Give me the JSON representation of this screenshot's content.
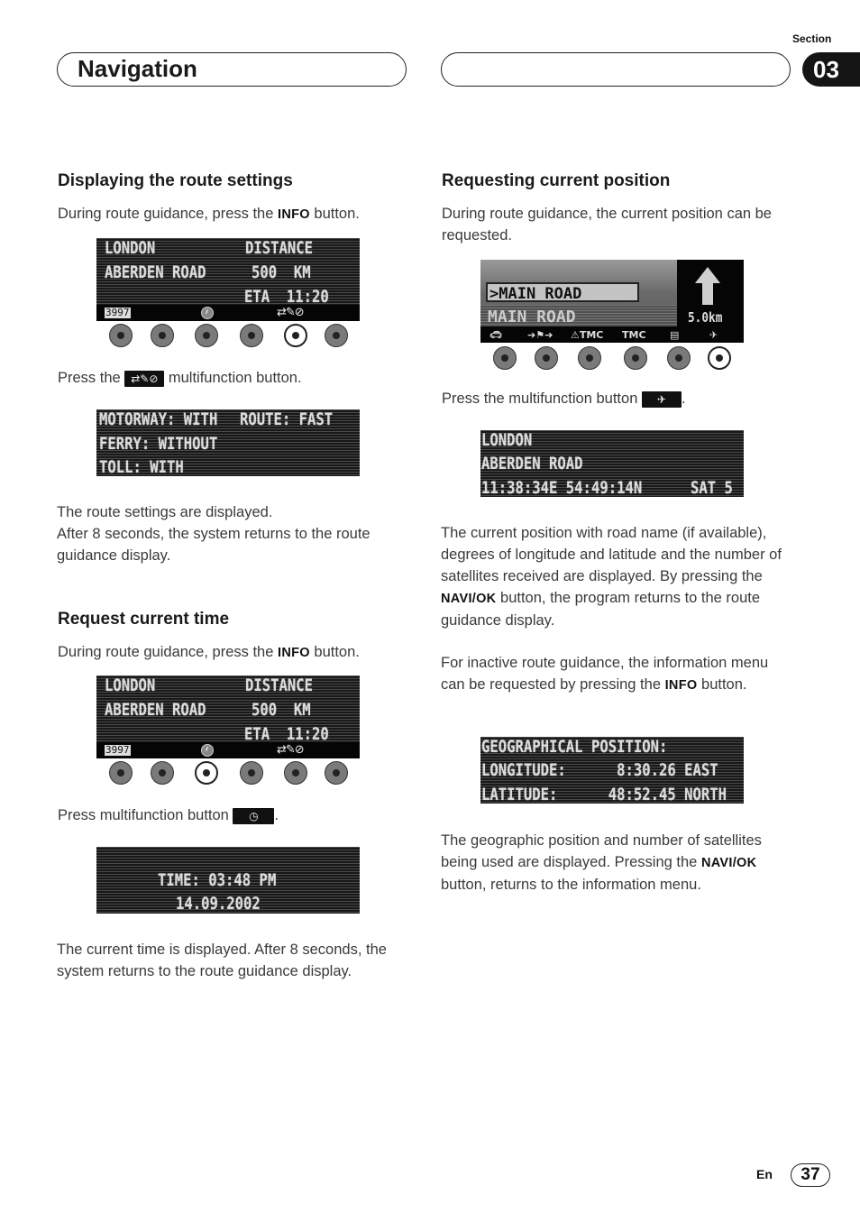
{
  "header": {
    "title": "Navigation",
    "section_label": "Section",
    "section_number": "03"
  },
  "left": {
    "route_settings": {
      "heading": "Displaying the route settings",
      "intro_pre": "During route guidance, press the ",
      "intro_bold": "INFO",
      "intro_post": " button.",
      "screen1": {
        "lines": [
          "LONDON",
          "ABERDEN ROAD"
        ],
        "right_lines": [
          "DISTANCE",
          "500  KM",
          "ETA  11:20"
        ],
        "odometer": "3997",
        "icons": [
          "clock-icon",
          "route-options-icon"
        ],
        "active_button": 5
      },
      "press_pre": "Press the ",
      "press_post": " multifunction button.",
      "screen2": {
        "lines": [
          "MOTORWAY: WITH",
          "FERRY: WITHOUT",
          "TOLL: WITH"
        ],
        "right_line": "ROUTE: FAST"
      },
      "result_text_1": "The route settings are displayed.",
      "result_text_2": "After 8 seconds, the system returns to the route guidance display."
    },
    "current_time": {
      "heading": "Request current time",
      "intro_pre": "During route guidance, press the ",
      "intro_bold": "INFO",
      "intro_post": " button.",
      "screen1": {
        "lines": [
          "LONDON",
          "ABERDEN ROAD"
        ],
        "right_lines": [
          "DISTANCE",
          "500  KM",
          "ETA  11:20"
        ],
        "odometer": "3997",
        "active_button": 3
      },
      "press_pre": "Press multifunction button ",
      "press_post": ".",
      "screen2": {
        "lines": [
          "TIME: 03:48 PM",
          "14.09.2002"
        ]
      },
      "result_text": "The current time is displayed. After 8 seconds, the system returns to the route guidance display."
    }
  },
  "right": {
    "current_position": {
      "heading": "Requesting current position",
      "intro": "During route guidance, the current position can be requested.",
      "map_screen": {
        "selected_road": ">MAIN ROAD",
        "road": "MAIN ROAD",
        "distance": "5.0km",
        "icons": [
          "car-icon",
          "route-flag-icon",
          "tmc-warning-icon",
          "tmc-icon",
          "list-icon",
          "satellite-icon"
        ],
        "active_button": 6
      },
      "press_pre": "Press the multifunction button ",
      "press_post": ".",
      "screen2": {
        "lines": [
          "LONDON",
          "ABERDEN ROAD",
          "11:38:34E 54:49:14N"
        ],
        "sat": "SAT 5"
      },
      "para1_pre": "The current position with road name (if available), degrees of longitude and latitude and the number of satellites received are displayed. By pressing the ",
      "para1_bold": "NAVI/OK",
      "para1_post": " button, the program returns to the route guidance display.",
      "para2_pre": "For inactive route guidance, the information menu can be requested by pressing the ",
      "para2_bold": "INFO",
      "para2_post": " button.",
      "screen3": {
        "lines": [
          "GEOGRAPHICAL POSITION:",
          "LONGITUDE:      8:30.26 EAST",
          "LATITUDE:      48:52.45 NORTH"
        ]
      },
      "para3_pre": "The geographic position and number of satellites being used are displayed. Pressing the ",
      "para3_bold": "NAVI/OK",
      "para3_post": " button, returns to the information menu."
    }
  },
  "footer": {
    "lang": "En",
    "page": "37"
  }
}
